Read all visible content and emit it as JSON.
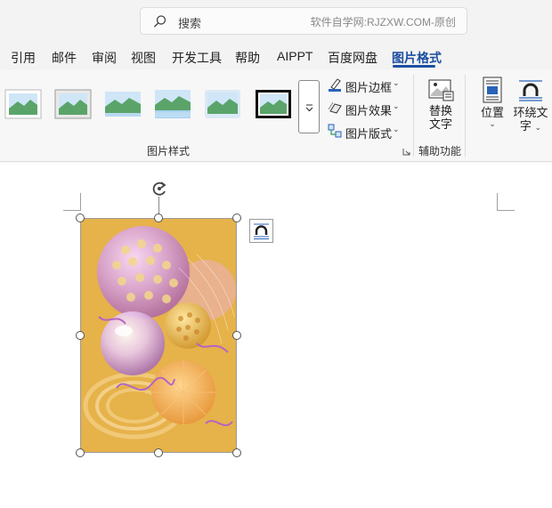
{
  "search": {
    "label": "搜索",
    "watermark": "软件自学网:RJZXW.COM-原创"
  },
  "tabs": [
    {
      "label": "引用"
    },
    {
      "label": "邮件"
    },
    {
      "label": "审阅"
    },
    {
      "label": "视图"
    },
    {
      "label": "开发工具"
    },
    {
      "label": "帮助"
    },
    {
      "label": "AIPPT"
    },
    {
      "label": "百度网盘"
    },
    {
      "label": "图片格式",
      "active": true
    }
  ],
  "ribbon": {
    "picture_styles": {
      "group_label": "图片样式",
      "more_icon": "chevron-down"
    },
    "commands": {
      "border": "图片边框",
      "effects": "图片效果",
      "layout": "图片版式"
    },
    "accessibility": {
      "alt_text_line1": "替换",
      "alt_text_line2": "文字",
      "group_label": "辅助功能"
    },
    "arrange": {
      "position": "位置",
      "wrap_line1": "环绕文",
      "wrap_line2": "字"
    }
  },
  "colors": {
    "accent": "#1c4fa0",
    "picture_bg": "#e6b24a"
  }
}
